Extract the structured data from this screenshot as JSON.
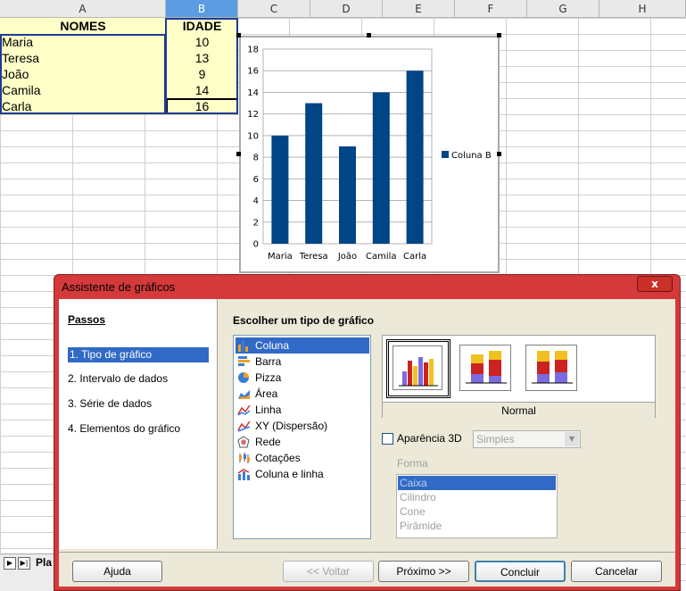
{
  "columns": [
    "A",
    "B",
    "C",
    "D",
    "E",
    "F",
    "G",
    "H"
  ],
  "sheet": {
    "header": {
      "a": "NOMES",
      "b": "IDADE"
    },
    "rows": [
      {
        "name": "Maria",
        "age": "10"
      },
      {
        "name": "Teresa",
        "age": "13"
      },
      {
        "name": "João",
        "age": "9"
      },
      {
        "name": "Camila",
        "age": "14"
      },
      {
        "name": "Carla",
        "age": "16"
      }
    ],
    "tab_label": "Pla"
  },
  "chart_data": {
    "type": "bar",
    "categories": [
      "Maria",
      "Teresa",
      "João",
      "Camila",
      "Carla"
    ],
    "series": [
      {
        "name": "Coluna B",
        "values": [
          10,
          13,
          9,
          14,
          16
        ],
        "color": "#004586"
      }
    ],
    "ylim": [
      0,
      18
    ],
    "yticks": [
      0,
      2,
      4,
      6,
      8,
      10,
      12,
      14,
      16,
      18
    ],
    "grid": true,
    "legend": "right"
  },
  "dialog": {
    "title": "Assistente de gráficos",
    "close_label": "x",
    "steps_title": "Passos",
    "steps": [
      "1. Tipo de gráfico",
      "2. Intervalo de dados",
      "3. Série de dados",
      "4. Elementos do gráfico"
    ],
    "choose_title": "Escolher um tipo de gráfico",
    "chart_types": [
      "Coluna",
      "Barra",
      "Pizza",
      "Área",
      "Linha",
      "XY (Dispersão)",
      "Rede",
      "Cotações",
      "Coluna e linha"
    ],
    "variant_label": "Normal",
    "appearance_3d": "Aparência 3D",
    "appearance_select": "Simples",
    "shape_label": "Forma",
    "shapes": [
      "Caixa",
      "Cilindro",
      "Cone",
      "Pirâmide"
    ],
    "buttons": {
      "help": "Ajuda",
      "back": "<< Voltar",
      "next": "Próximo >>",
      "finish": "Concluir",
      "cancel": "Cancelar"
    }
  }
}
